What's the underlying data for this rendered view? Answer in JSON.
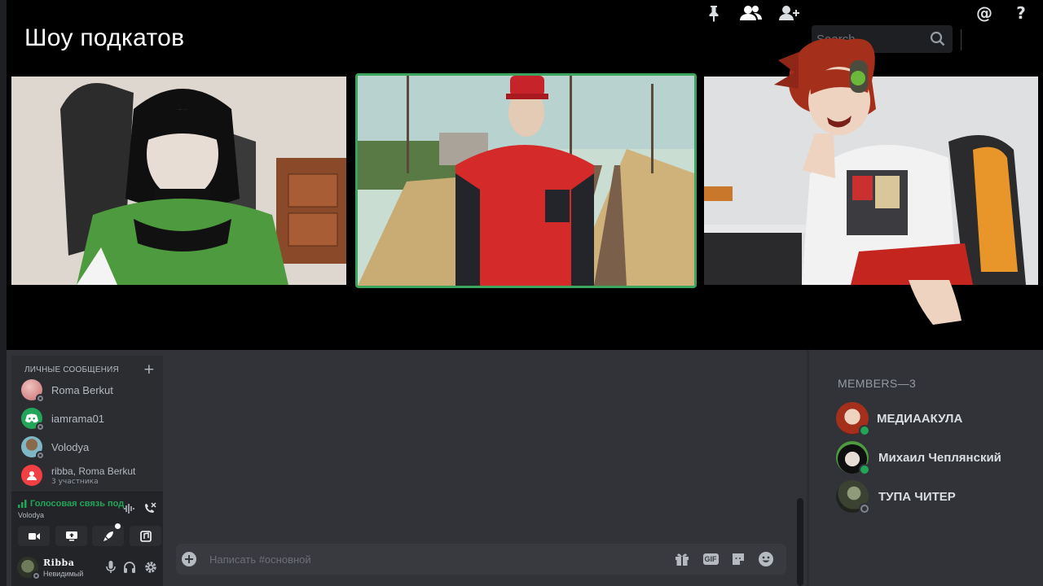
{
  "header": {
    "title": "Шоу подкатов",
    "search_placeholder": "Search"
  },
  "toolbar": {
    "icons": [
      "pin-icon",
      "members-icon",
      "add-friend-icon",
      "mention-icon",
      "help-icon"
    ],
    "mention_glyph": "@",
    "help_glyph": "?"
  },
  "video_tiles": [
    {
      "name": "tile-girl-green-sweater",
      "speaking": false
    },
    {
      "name": "tile-man-red-jacket",
      "speaking": true
    },
    {
      "name": "tile-red-haired-streamer",
      "speaking": false
    }
  ],
  "dm": {
    "header": "ЛИЧНЫЕ СООБЩЕНИЯ",
    "add_glyph": "+",
    "items": [
      {
        "name": "Roma Berkut",
        "sub": "",
        "avatar_color": "#d98a8e"
      },
      {
        "name": "iamrama01",
        "sub": "",
        "avatar_color": "#23a559"
      },
      {
        "name": "Volodya",
        "sub": "",
        "avatar_color": "#7fb7c7"
      },
      {
        "name": "ribba, Roma Berkut",
        "sub": "3 участника",
        "avatar_color": "#f23f43"
      }
    ]
  },
  "voice": {
    "status": "Голосовая связь под",
    "channel": "Volodya"
  },
  "user": {
    "name": "Ribba",
    "status": "Невидимый"
  },
  "chat": {
    "placeholder": "Написать #основной",
    "gif_label": "GIF"
  },
  "members": {
    "header": "MEMBERS—3",
    "list": [
      {
        "name": "МЕДИААКУЛА",
        "online": true
      },
      {
        "name": "Михаил Чеплянский",
        "online": true
      },
      {
        "name": "ТУПА ЧИТЕР",
        "online": false
      }
    ]
  },
  "colors": {
    "accent_green": "#23a559",
    "speaking_border": "#3ba55d",
    "bg_dark": "#313338",
    "panel": "#2b2d31"
  }
}
